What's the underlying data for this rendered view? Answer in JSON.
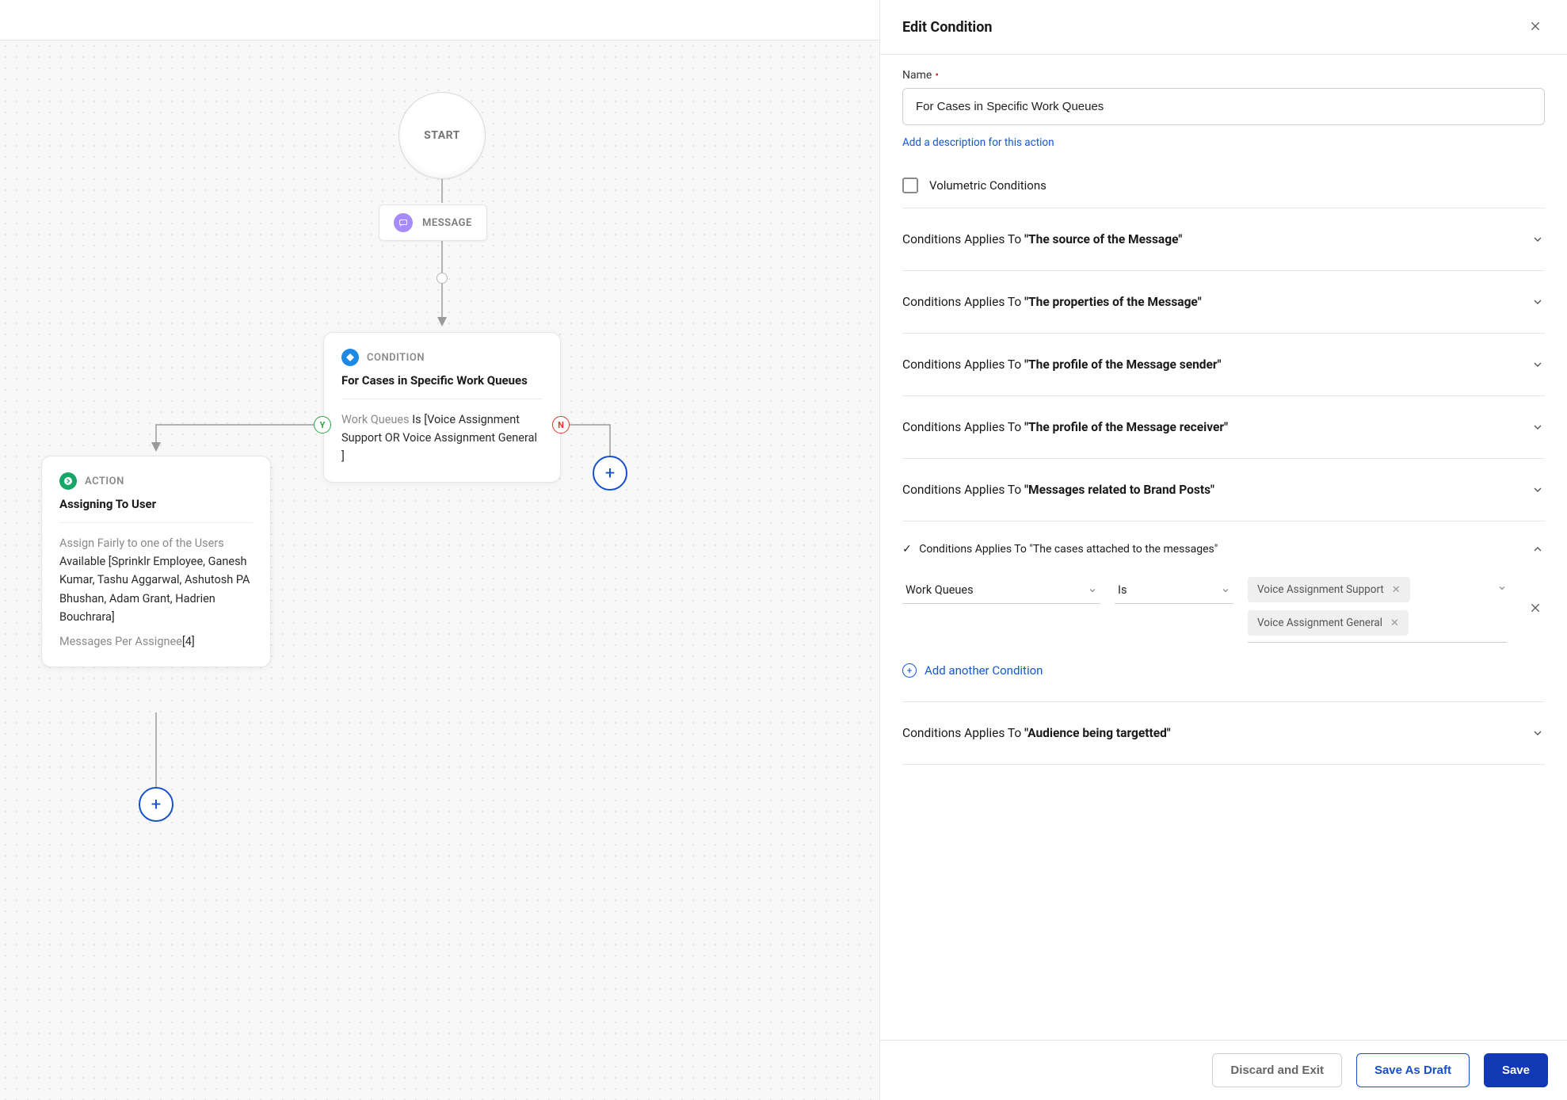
{
  "canvas": {
    "start_label": "START",
    "message_chip": "MESSAGE",
    "condition": {
      "tag": "CONDITION",
      "title": "For Cases in Specific Work Queues",
      "field_label": "Work Queues",
      "op": "Is",
      "value": "[Voice Assignment Support OR Voice Assignment General ]"
    },
    "action": {
      "tag": "ACTION",
      "title": "Assigning To User",
      "body_label": "Assign Fairly to one of the Users",
      "body_value": "Available [Sprinklr Employee, Ganesh Kumar, Tashu Aggarwal, Ashutosh PA Bhushan, Adam Grant, Hadrien Bouchrara]",
      "messages_per_label": "Messages Per Assignee",
      "messages_per_value": "[4]"
    },
    "yes": "Y",
    "no": "N"
  },
  "panel": {
    "header": "Edit Condition",
    "name_label": "Name",
    "name_value": "For Cases in Specific Work Queues",
    "add_desc_link": "Add a description for this action",
    "volumetric_label": "Volumetric Conditions",
    "applies_prefix": "Conditions Applies To ",
    "sections": [
      {
        "label": "\"The source of the Message\""
      },
      {
        "label": "\"The properties of the Message\""
      },
      {
        "label": "\"The profile of the Message sender\""
      },
      {
        "label": "\"The profile of the Message receiver\""
      },
      {
        "label": "\"Messages related to Brand Posts\""
      }
    ],
    "expanded": {
      "label": "\"The cases attached to the messages\"",
      "field": "Work Queues",
      "op": "Is",
      "tags": [
        "Voice Assignment Support",
        "Voice Assignment General"
      ],
      "add_another": "Add another Condition"
    },
    "section_after": {
      "label": "\"Audience being targetted\""
    },
    "footer": {
      "discard": "Discard and Exit",
      "draft": "Save As Draft",
      "save": "Save"
    }
  }
}
